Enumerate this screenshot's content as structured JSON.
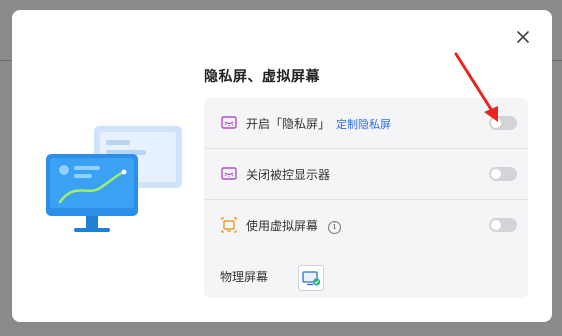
{
  "dialog": {
    "title": "隐私屏、虚拟屏幕",
    "close_icon": "close-icon",
    "rows": [
      {
        "icon": "privacy-screen-icon",
        "label": "开启「隐私屏」",
        "link": "定制隐私屏",
        "toggle_on": false
      },
      {
        "icon": "monitor-off-icon",
        "label": "关闭被控显示器",
        "toggle_on": false
      },
      {
        "icon": "virtual-screen-icon",
        "label": "使用虚拟屏幕",
        "info_icon": "i",
        "toggle_on": false
      }
    ],
    "physical_screen": {
      "label": "物理屏幕",
      "icon": "monitor-check-icon"
    }
  },
  "colors": {
    "accent": "#2b6de3",
    "annotation_arrow": "#e8261f",
    "privacy_icon": "#b14fc9",
    "virtual_icon": "#e8a020"
  }
}
